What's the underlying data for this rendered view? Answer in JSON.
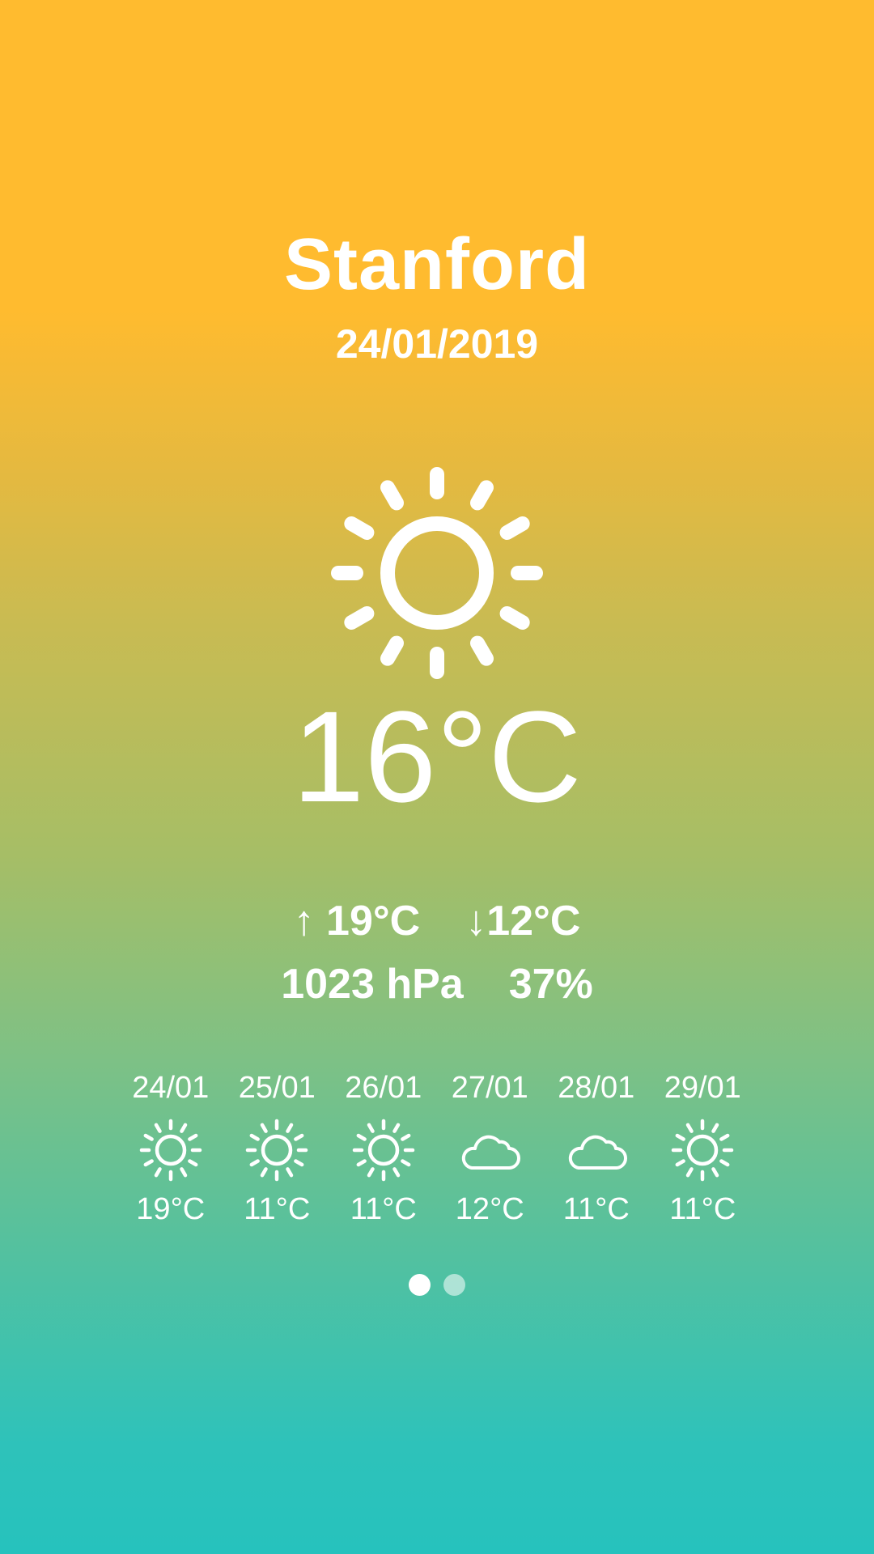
{
  "location": {
    "city": "Stanford",
    "date": "24/01/2019"
  },
  "current": {
    "icon": "sun-icon",
    "temperature": "16°C",
    "high": "↑ 19°C",
    "low": "↓12°C",
    "pressure": "1023 hPa",
    "humidity": "37%"
  },
  "forecast": [
    {
      "date": "24/01",
      "icon": "sun-icon",
      "temp": "19°C"
    },
    {
      "date": "25/01",
      "icon": "sun-icon",
      "temp": "11°C"
    },
    {
      "date": "26/01",
      "icon": "sun-icon",
      "temp": "11°C"
    },
    {
      "date": "27/01",
      "icon": "cloud-icon",
      "temp": "12°C"
    },
    {
      "date": "28/01",
      "icon": "cloud-icon",
      "temp": "11°C"
    },
    {
      "date": "29/01",
      "icon": "sun-icon",
      "temp": "11°C"
    }
  ],
  "pager": {
    "page_count": 2,
    "current_page": 1
  },
  "colors": {
    "top": "#FFBB2F",
    "bottom": "#26C2BD",
    "text": "#ffffff"
  }
}
